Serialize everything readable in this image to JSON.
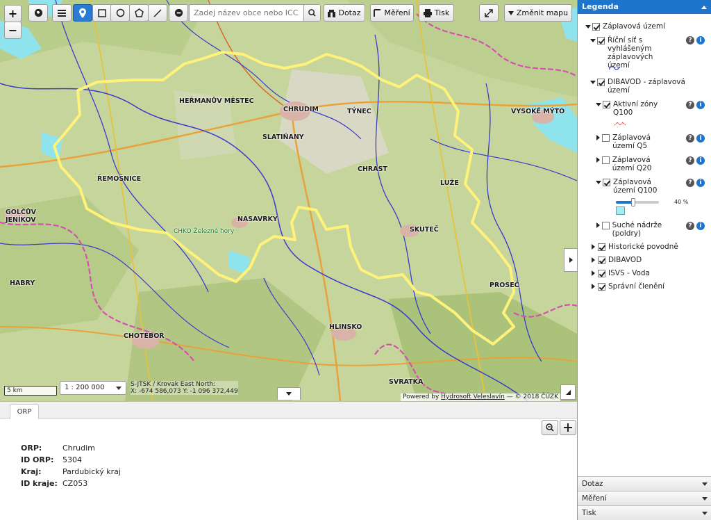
{
  "toolbar": {
    "search_placeholder": "Zadej název obce nebo ICC",
    "query_label": "Dotaz",
    "measure_label": "Měření",
    "print_label": "Tisk",
    "change_map_label": "Změnit mapu"
  },
  "map": {
    "scalebar_label": "5 km",
    "scale_value": "1 : 200 000",
    "coord_line1": "S-JTSK / Krovak East North:",
    "coord_line2": "X: -674 586,073 Y: -1 096 372,449",
    "powered_prefix": "Powered by",
    "powered_link": "Hydrosoft Veleslavín",
    "copyright": "— © 2018 ČÚZK",
    "labels": {
      "chrudim": "CHRUDIM",
      "hermanuv": "HEŘMANŮV MĚSTEC",
      "tynec": "TÝNEC",
      "slatinany": "SLATIŇANY",
      "chrast": "CHRAST",
      "premysl": "ŘEMOŠNICE",
      "nasavrky": "NASAVRKY",
      "skutec": "SKUTEČ",
      "luze": "LUŽE",
      "proseč": "PROSEČ",
      "hlinsko": "HLINSKO",
      "chotebor": "CHOTĚBOŘ",
      "vysoke": "VYSOKÉ MÝTO",
      "habry": "HABRY",
      "golcuv": "GOLČŮV JENÍKOV",
      "chko": "CHKO Železné hory",
      "svratka": "SVRATKA"
    }
  },
  "bottom": {
    "tab_label": "ORP",
    "attributes": [
      {
        "key": "ORP",
        "value": "Chrudim"
      },
      {
        "key": "ID ORP",
        "value": "5304"
      },
      {
        "key": "Kraj",
        "value": "Pardubický kraj"
      },
      {
        "key": "ID kraje",
        "value": "CZ053"
      }
    ]
  },
  "legend": {
    "title": "Legenda",
    "root": "Záplavová území",
    "river_net": "Říční síť s vyhlášeným záplavových území",
    "dibavod_zones": "DIBAVOD - záplavová území",
    "active_zones": "Aktivní zóny Q100",
    "q5": "Záplavová území Q5",
    "q20": "Záplavová území Q20",
    "q100": "Záplavová území Q100",
    "opacity": "40 %",
    "opacity_fraction": 0.4,
    "dry_tanks": "Suché nádrže (poldry)",
    "historic": "Historické povodně",
    "dibavod": "DIBAVOD",
    "isvs": "ISVS - Voda",
    "admin": "Správní členění",
    "acc_query": "Dotaz",
    "acc_measure": "Měření",
    "acc_print": "Tisk"
  },
  "colors": {
    "accent": "#1e75cc",
    "boundary": "#fff27a",
    "flood": "#a6eef4"
  }
}
